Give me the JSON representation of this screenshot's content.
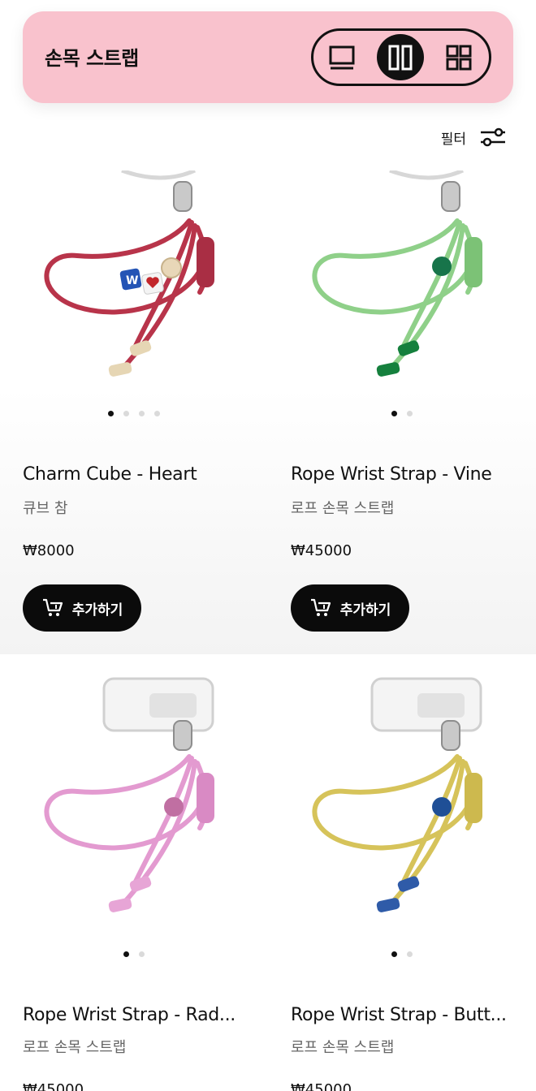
{
  "header": {
    "title": "손목 스트랩"
  },
  "filter": {
    "label": "필터"
  },
  "products": [
    {
      "name": "Charm Cube - Heart",
      "subtitle": "큐브 참",
      "price": "₩8000",
      "add_label": "추가하기"
    },
    {
      "name": "Rope Wrist Strap - Vine",
      "subtitle": "로프 손목 스트랩",
      "price": "₩45000",
      "add_label": "추가하기"
    },
    {
      "name": "Rope Wrist Strap - Rad...",
      "subtitle": "로프 손목 스트랩",
      "price": "₩45000"
    },
    {
      "name": "Rope Wrist Strap - Butt...",
      "subtitle": "로프 손목 스트랩",
      "price": "₩45000"
    }
  ],
  "colors": {
    "header_bg": "#f9c2cd",
    "strap_red": "#b8344a",
    "strap_green": "#8fd089",
    "strap_pink": "#e39ad0",
    "strap_yellow": "#d6c35a"
  }
}
